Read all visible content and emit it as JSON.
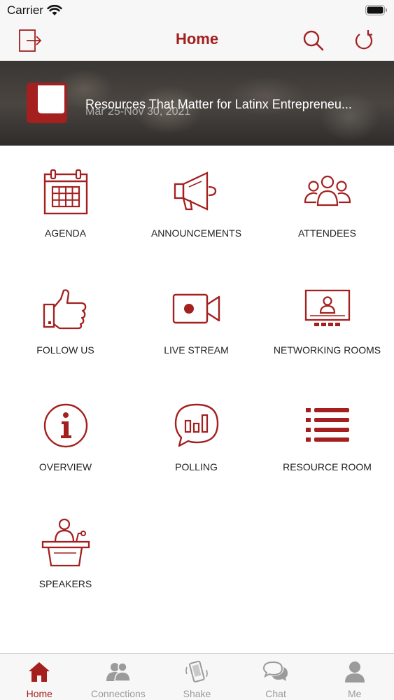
{
  "status_bar": {
    "carrier": "Carrier"
  },
  "nav": {
    "title": "Home"
  },
  "banner": {
    "title": "Resources That Matter for Latinx Entrepreneu...",
    "date": "Mar 25-Nov 30, 2021"
  },
  "tiles": [
    {
      "label": "AGENDA",
      "icon": "calendar-icon"
    },
    {
      "label": "ANNOUNCEMENTS",
      "icon": "megaphone-icon"
    },
    {
      "label": "ATTENDEES",
      "icon": "people-icon"
    },
    {
      "label": "FOLLOW US",
      "icon": "thumbs-up-icon"
    },
    {
      "label": "LIVE STREAM",
      "icon": "video-camera-icon"
    },
    {
      "label": "NETWORKING ROOMS",
      "icon": "monitor-user-icon"
    },
    {
      "label": "OVERVIEW",
      "icon": "info-icon"
    },
    {
      "label": "POLLING",
      "icon": "poll-bubble-icon"
    },
    {
      "label": "RESOURCE ROOM",
      "icon": "list-icon"
    },
    {
      "label": "SPEAKERS",
      "icon": "podium-icon"
    }
  ],
  "tabs": [
    {
      "label": "Home",
      "icon": "home-icon",
      "active": true
    },
    {
      "label": "Connections",
      "icon": "connections-icon",
      "active": false
    },
    {
      "label": "Shake",
      "icon": "shake-phone-icon",
      "active": false
    },
    {
      "label": "Chat",
      "icon": "chat-icon",
      "active": false
    },
    {
      "label": "Me",
      "icon": "person-icon",
      "active": false
    }
  ],
  "colors": {
    "accent": "#a3201f",
    "tab_inactive": "#9b9b9b",
    "bar_bg": "#f7f7f7"
  }
}
